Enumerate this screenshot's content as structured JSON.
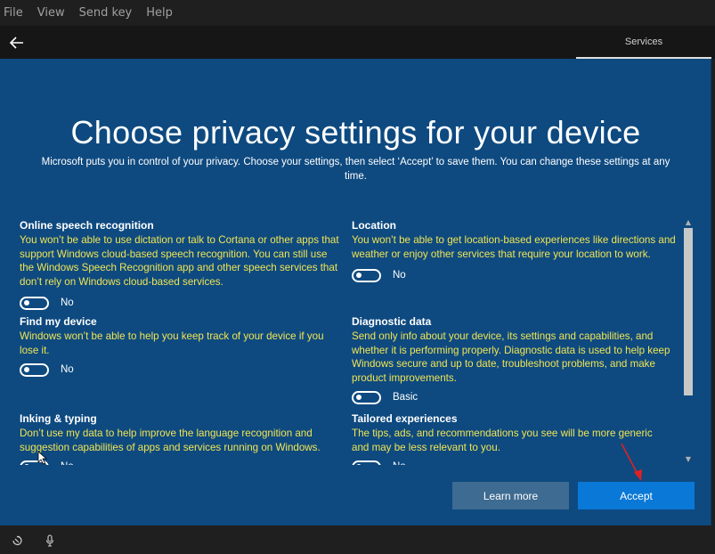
{
  "menubar": {
    "items": [
      "File",
      "View",
      "Send key",
      "Help"
    ]
  },
  "header": {
    "back_icon": "arrow-left-icon",
    "tab_label": "Services"
  },
  "page": {
    "title": "Choose privacy settings for your device",
    "subtitle": "Microsoft puts you in control of your privacy. Choose your settings, then select ‘Accept’ to save them. You can change these settings at any time."
  },
  "settings": [
    {
      "title": "Online speech recognition",
      "description": "You won’t be able to use dictation or talk to Cortana or other apps that support Windows cloud-based speech recognition. You can still use the Windows Speech Recognition app and other speech services that don’t rely on Windows cloud-based services.",
      "toggle_label": "No"
    },
    {
      "title": "Location",
      "description": "You won’t be able to get location-based experiences like directions and weather or enjoy other services that require your location to work.",
      "toggle_label": "No"
    },
    {
      "title": "Find my device",
      "description": "Windows won’t be able to help you keep track of your device if you lose it.",
      "toggle_label": "No"
    },
    {
      "title": "Diagnostic data",
      "description": "Send only info about your device, its settings and capabilities, and whether it is performing properly. Diagnostic data is used to help keep Windows secure and up to date, troubleshoot problems, and make product improvements.",
      "toggle_label": "Basic"
    },
    {
      "title": "Inking & typing",
      "description": "Don’t use my data to help improve the language recognition and suggestion capabilities of apps and services running on Windows.",
      "toggle_label": "No"
    },
    {
      "title": "Tailored experiences",
      "description": "The tips, ads, and recommendations you see will be more generic and may be less relevant to you.",
      "toggle_label": "No"
    }
  ],
  "buttons": {
    "learn_more": "Learn more",
    "accept": "Accept"
  },
  "colors": {
    "background_blue": "#0e4a80",
    "description_yellow": "#f1e552",
    "accept_blue": "#0a78d7",
    "learn_more_blue": "#3e6b91",
    "annotation_red": "#e02020"
  },
  "bottombar": {
    "icons": [
      "ease-of-access-icon",
      "microphone-icon"
    ]
  }
}
